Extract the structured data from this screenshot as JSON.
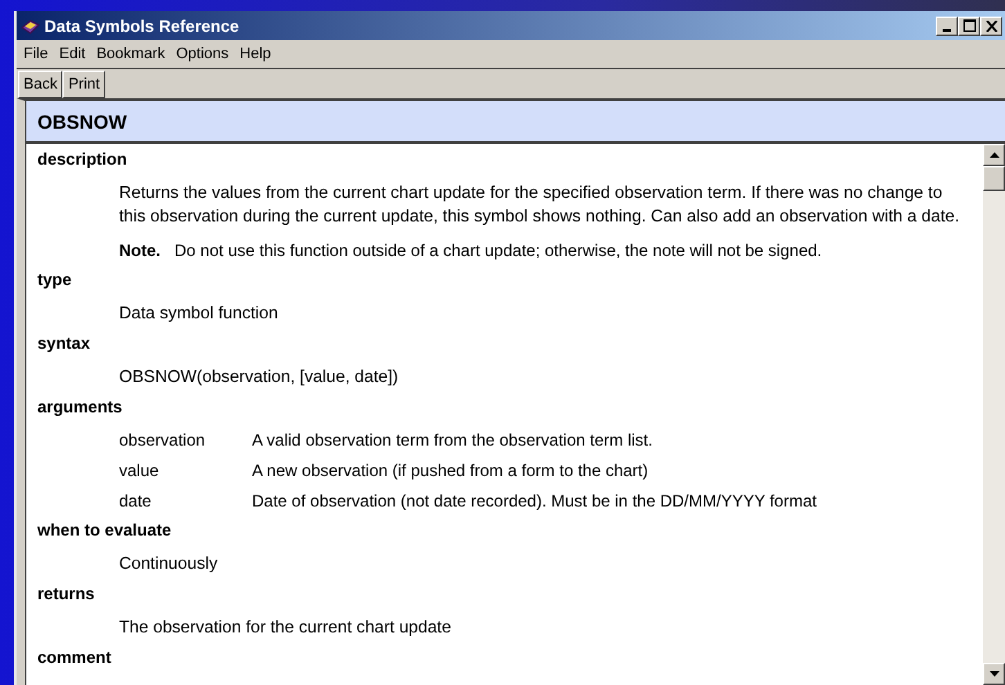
{
  "window": {
    "title": "Data Symbols Reference"
  },
  "menu": [
    {
      "label": "File"
    },
    {
      "label": "Edit"
    },
    {
      "label": "Bookmark"
    },
    {
      "label": "Options"
    },
    {
      "label": "Help"
    }
  ],
  "toolbar": [
    {
      "label": "Back"
    },
    {
      "label": "Print"
    }
  ],
  "topic": {
    "title": "OBSNOW"
  },
  "sections": [
    {
      "heading": "description",
      "kind": "text",
      "paragraphs": [
        "Returns the values from the current chart update for the specified observation term. If there was no change to this observation during the current update, this symbol shows nothing. Can also add an observation with a date."
      ],
      "note": {
        "label": "Note.",
        "text": "Do not use this function outside of a chart update; otherwise, the note will not be signed."
      }
    },
    {
      "heading": "type",
      "kind": "text",
      "paragraphs": [
        "Data symbol function"
      ]
    },
    {
      "heading": "syntax",
      "kind": "text",
      "paragraphs": [
        "OBSNOW(observation, [value, date])"
      ]
    },
    {
      "heading": "arguments",
      "kind": "table",
      "rows": [
        {
          "name": "observation",
          "text": "A valid observation term from the observation term list."
        },
        {
          "name": "value",
          "text": "A new observation (if pushed from a form to the chart)"
        },
        {
          "name": "date",
          "text": "Date of observation (not date recorded). Must be in the DD/MM/YYYY format"
        }
      ]
    },
    {
      "heading": "when to evaluate",
      "kind": "text",
      "paragraphs": [
        "Continuously"
      ]
    },
    {
      "heading": "returns",
      "kind": "text",
      "paragraphs": [
        "The observation for the current chart update"
      ]
    },
    {
      "heading": "comment",
      "kind": "text"
    }
  ]
}
